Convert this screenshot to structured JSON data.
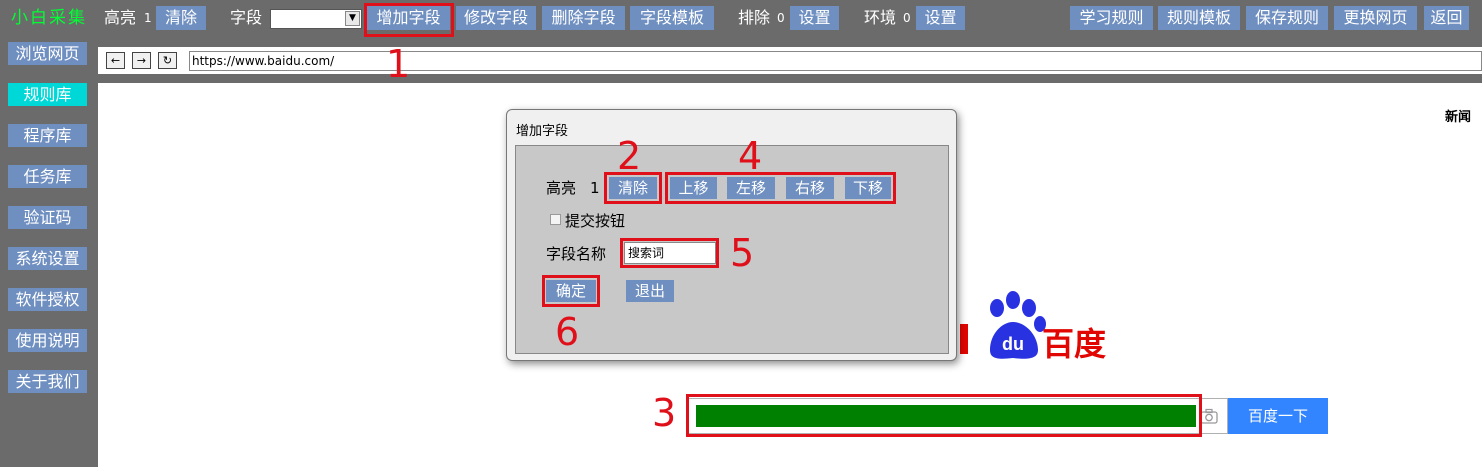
{
  "app": {
    "title": "小白采集"
  },
  "toolbar": {
    "highlight_label": "高亮",
    "highlight_count": "1",
    "clear_label": "清除",
    "field_label": "字段",
    "field_select_value": "",
    "add_field": "增加字段",
    "modify_field": "修改字段",
    "delete_field": "删除字段",
    "field_template": "字段模板",
    "exclude_label": "排除",
    "exclude_count": "0",
    "exclude_settings": "设置",
    "env_label": "环境",
    "env_count": "0",
    "env_settings": "设置",
    "learn_rules": "学习规则",
    "rule_template": "规则模板",
    "save_rules": "保存规则",
    "change_page": "更换网页",
    "back": "返回"
  },
  "sidebar": {
    "items": [
      {
        "label": "浏览网页",
        "active": false
      },
      {
        "label": "规则库",
        "active": true
      },
      {
        "label": "程序库",
        "active": false
      },
      {
        "label": "任务库",
        "active": false
      },
      {
        "label": "验证码",
        "active": false
      },
      {
        "label": "系统设置",
        "active": false
      },
      {
        "label": "软件授权",
        "active": false
      },
      {
        "label": "使用说明",
        "active": false
      },
      {
        "label": "关于我们",
        "active": false
      }
    ]
  },
  "browser": {
    "back_icon": "←",
    "forward_icon": "→",
    "refresh_icon": "↻",
    "url": "https://www.baidu.com/"
  },
  "page": {
    "news_link": "新闻",
    "search_button": "百度一下",
    "logo_text": "百度"
  },
  "dialog": {
    "title": "增加字段",
    "highlight_label": "高亮",
    "highlight_count": "1",
    "clear": "清除",
    "move_up": "上移",
    "move_left": "左移",
    "move_right": "右移",
    "move_down": "下移",
    "submit_checkbox_label": "提交按钮",
    "field_name_label": "字段名称",
    "field_name_value": "搜索词",
    "confirm": "确定",
    "exit": "退出"
  },
  "annotations": [
    "1",
    "2",
    "3",
    "4",
    "5",
    "6"
  ],
  "colors": {
    "toolbar_bg": "#6b6b6b",
    "button_bg": "#6f8fc0",
    "active_item": "#00d8d8",
    "title_green": "#00ff33",
    "annotation_red": "#e0101a",
    "search_fill": "#008000",
    "baidu_blue": "#3385ff"
  }
}
